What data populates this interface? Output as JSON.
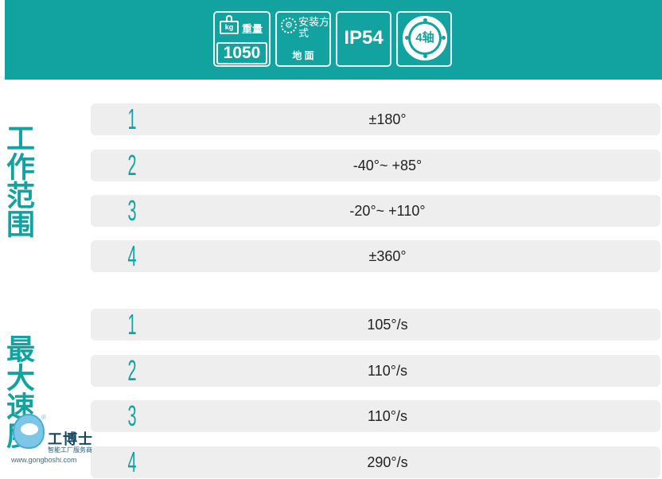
{
  "specs": {
    "weight": {
      "icon": "weight-icon",
      "unit": "kg",
      "label": "重量",
      "value": "1050"
    },
    "mounting": {
      "icon": "wrench-icon",
      "label": "安装方式",
      "value": "地 面"
    },
    "protection": {
      "label": "IP54"
    },
    "axes": {
      "icon": "axis-flange-icon",
      "label": "4轴"
    }
  },
  "sections": {
    "working_range": {
      "title": "工作范围",
      "rows": [
        {
          "axis": "1",
          "value": "±180°"
        },
        {
          "axis": "2",
          "value": "-40°~ +85°"
        },
        {
          "axis": "3",
          "value": "-20°~ +110°"
        },
        {
          "axis": "4",
          "value": "±360°"
        }
      ]
    },
    "max_speed": {
      "title": "最大速度",
      "rows": [
        {
          "axis": "1",
          "value": "105°/s"
        },
        {
          "axis": "2",
          "value": "110°/s"
        },
        {
          "axis": "3",
          "value": "110°/s"
        },
        {
          "axis": "4",
          "value": "290°/s"
        }
      ]
    }
  },
  "watermark": {
    "brand": "工博士",
    "subtitle": "智能工厂服务商",
    "url": "www.gongboshi.com",
    "registered_mark": "®"
  },
  "colors": {
    "accent": "#12a2a0",
    "row_bg": "#eeeeee",
    "text": "#222222"
  }
}
